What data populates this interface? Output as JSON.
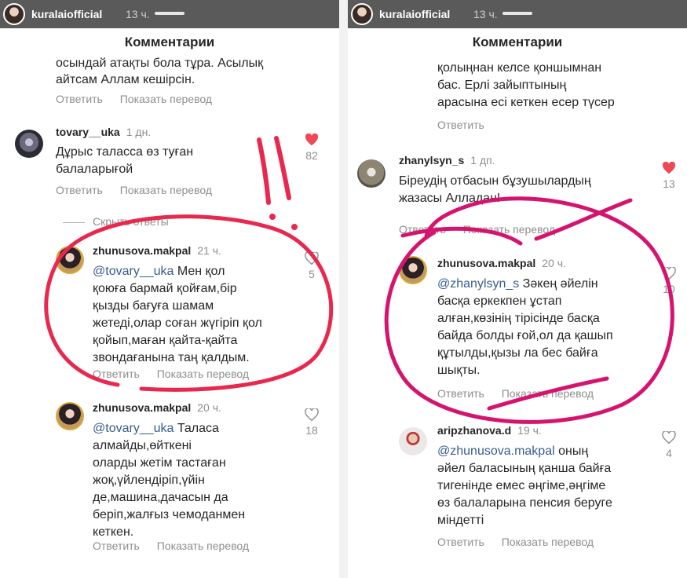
{
  "left": {
    "story": {
      "username": "kuralaiofficial",
      "time": "13 ч."
    },
    "header_title": "Комментарии",
    "cut_comment": {
      "line1": "осындай атақты бола тұра. Асылық",
      "line2": "айтсам Аллам кешірсін.",
      "reply": "Ответить",
      "translate": "Показать перевод"
    },
    "comments": [
      {
        "username": "tovary__uka",
        "time": "1 дн.",
        "text": "Дұрыс таласса өз туған\nбалаларығой",
        "reply": "Ответить",
        "translate": "Показать перевод",
        "likes": "82",
        "liked": true
      }
    ],
    "hide_replies": "Скрыть ответы",
    "replies": [
      {
        "username": "zhunusova.makpal",
        "time": "21 ч.",
        "mention": "@tovary__uka",
        "text": " Мен қол\nқоюға бармай қойғам,бір\nқызды бағуға шамам\nжетеді,олар соған жүгіріп  қол\nқойып,маған қайта-қайта\nзвондағанына таң қалдым.",
        "reply": "Ответить",
        "translate": "Показать перевод",
        "likes": "5"
      },
      {
        "username": "zhunusova.makpal",
        "time": "20 ч.",
        "mention": "@tovary__uka",
        "text": " Таласа\nалмайды,өйткені\nоларды жетім тастаған\nжоқ,үйлендіріп,үйін\nде,машина,дачасын да\nберіп,жалғыз чемоданмен\nкеткен.",
        "reply": "Ответить",
        "translate": "Показать перевод",
        "likes": "18"
      }
    ]
  },
  "right": {
    "story": {
      "username": "kuralaiofficial",
      "time": "13 ч."
    },
    "header_title": "Комментарии",
    "cut_comment": {
      "line1": "қолыңнан келсе қоншымнан",
      "line2": "бас. Ерлі зайыптының",
      "line3": "арасына есі кеткен есер түсер",
      "reply": "Ответить"
    },
    "comments": [
      {
        "username": "zhanylsyn_s",
        "time": "1 дп.",
        "text": "Біреудің отбасын бұзушылардың\nжазасы Алладан!",
        "reply": "Ответить",
        "translate": "Показать перевод",
        "likes": "13",
        "liked": true
      },
      {
        "username": "zhunusova.makpal",
        "time": "20 ч.",
        "mention": "@zhanylsyn_s",
        "text": " Зәкең әйелін\nбасқа еркекпен ұстап\nалған,көзінің тірісінде басқа\nбайда болды ғой,ол да қашып\nқұтылды,қызы ла бес байға\nшықты.",
        "reply": "Ответить",
        "translate": "Показать перевод",
        "likes": "10"
      },
      {
        "username": "aripzhanova.d",
        "time": "19 ч.",
        "mention": "@zhunusova.makpal",
        "text": " оның\nәйел баласының  қанша байға\nтигенінде емес әңгіме,әңгіме\nөз балаларына пенсия беруге\nміндетті",
        "reply": "Ответить",
        "translate": "Показать перевод",
        "likes": "4"
      }
    ]
  },
  "colors": {
    "heart_red": "#ed4956",
    "annotation_red": "#e8284e",
    "annotation_magenta": "#d4146e",
    "mention_blue": "#375d8f"
  }
}
